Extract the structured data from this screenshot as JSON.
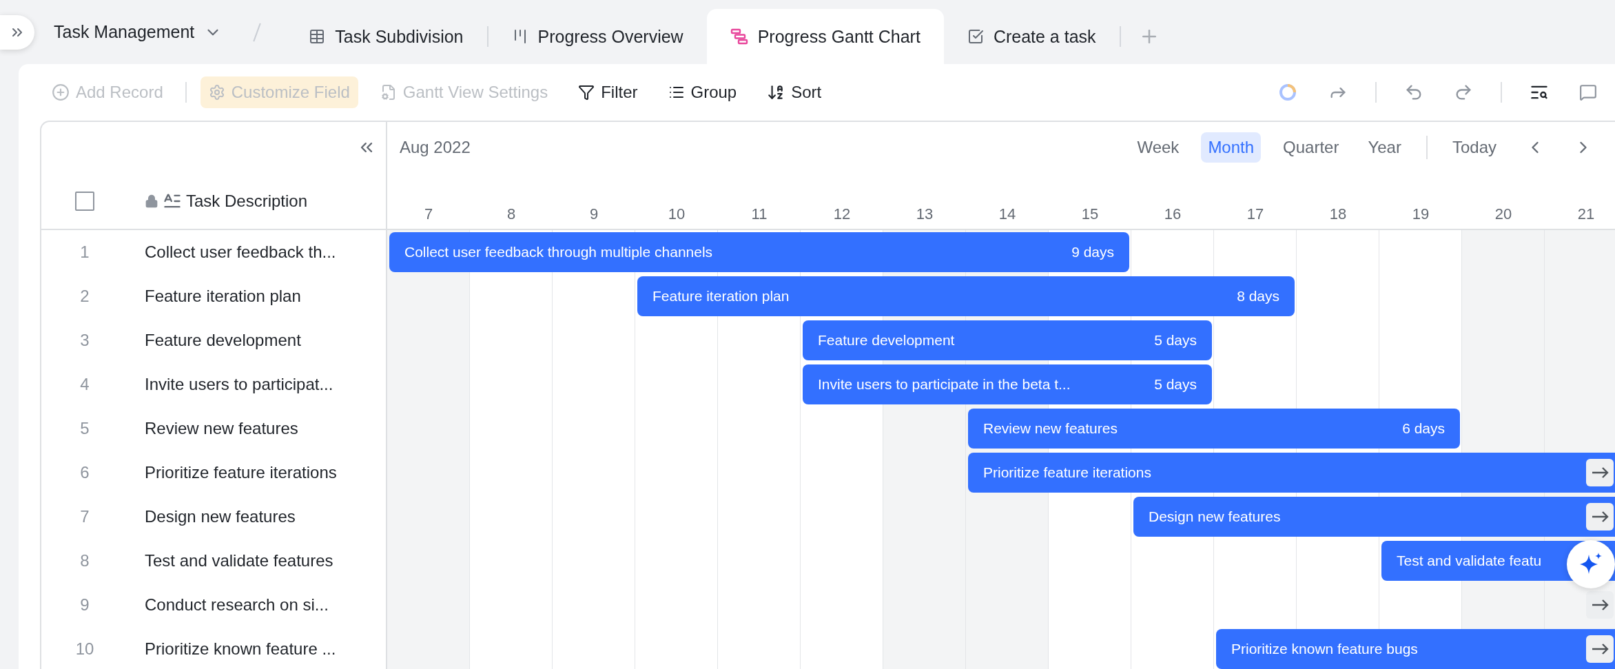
{
  "view_group": {
    "title": "Task Management"
  },
  "tabs": [
    {
      "label": "Task Subdivision",
      "kind": "grid",
      "selected": false
    },
    {
      "label": "Progress Overview",
      "kind": "kanban",
      "selected": false
    },
    {
      "label": "Progress Gantt Chart",
      "kind": "gantt",
      "selected": true
    },
    {
      "label": "Create a task",
      "kind": "form",
      "selected": false
    }
  ],
  "toolbar": [
    {
      "label": "Add Record",
      "kind": "add",
      "disabled": true,
      "highlighted": false
    },
    {
      "label": "Customize Field",
      "kind": "field",
      "disabled": true,
      "highlighted": true
    },
    {
      "label": "Gantt View Settings",
      "kind": "settings",
      "disabled": true,
      "highlighted": false
    },
    {
      "label": "Filter",
      "kind": "filter",
      "disabled": false,
      "highlighted": false
    },
    {
      "label": "Group",
      "kind": "group",
      "disabled": false,
      "highlighted": false
    },
    {
      "label": "Sort",
      "kind": "sort",
      "disabled": false,
      "highlighted": false
    }
  ],
  "gantt": {
    "month": "Aug 2022",
    "select_all": {
      "checked": false
    },
    "scales": [
      {
        "label": "Week",
        "selected": false
      },
      {
        "label": "Month",
        "selected": true
      },
      {
        "label": "Quarter",
        "selected": false
      },
      {
        "label": "Year",
        "selected": false
      }
    ],
    "today": "Today",
    "column_header": "Task Description",
    "days": [
      {
        "label": "7",
        "weekend": true
      },
      {
        "label": "8",
        "weekend": false
      },
      {
        "label": "9",
        "weekend": false
      },
      {
        "label": "10",
        "weekend": false
      },
      {
        "label": "11",
        "weekend": false
      },
      {
        "label": "12",
        "weekend": false
      },
      {
        "label": "13",
        "weekend": true
      },
      {
        "label": "14",
        "weekend": true
      },
      {
        "label": "15",
        "weekend": false
      },
      {
        "label": "16",
        "weekend": false
      },
      {
        "label": "17",
        "weekend": false
      },
      {
        "label": "18",
        "weekend": false
      },
      {
        "label": "19",
        "weekend": false
      },
      {
        "label": "20",
        "weekend": true
      },
      {
        "label": "21",
        "weekend": true
      }
    ],
    "rows": [
      {
        "number": "1",
        "description": "Collect user feedback th...",
        "bar": {
          "kind": "bounded",
          "label": "Collect user feedback through multiple channels",
          "duration": "9 days"
        },
        "timeline": [
          {
            "kind": "span"
          },
          {
            "kind": "span"
          },
          {
            "kind": "span"
          },
          {
            "kind": "span"
          },
          {
            "kind": "span"
          },
          {
            "kind": "span"
          },
          {
            "kind": "span"
          },
          {
            "kind": "span"
          },
          {
            "kind": "span"
          },
          {
            "kind": "gap"
          },
          {
            "kind": "gap"
          },
          {
            "kind": "gap"
          },
          {
            "kind": "gap"
          },
          {
            "kind": "gap"
          },
          {
            "kind": "gap"
          }
        ]
      },
      {
        "number": "2",
        "description": "Feature iteration plan",
        "bar": {
          "kind": "bounded",
          "label": "Feature iteration plan",
          "duration": "8 days"
        },
        "timeline": [
          {
            "kind": "gap"
          },
          {
            "kind": "gap"
          },
          {
            "kind": "gap"
          },
          {
            "kind": "span"
          },
          {
            "kind": "span"
          },
          {
            "kind": "span"
          },
          {
            "kind": "span"
          },
          {
            "kind": "span"
          },
          {
            "kind": "span"
          },
          {
            "kind": "span"
          },
          {
            "kind": "span"
          },
          {
            "kind": "gap"
          },
          {
            "kind": "gap"
          },
          {
            "kind": "gap"
          },
          {
            "kind": "gap"
          }
        ]
      },
      {
        "number": "3",
        "description": "Feature development",
        "bar": {
          "kind": "bounded",
          "label": "Feature development",
          "duration": "5 days"
        },
        "timeline": [
          {
            "kind": "gap"
          },
          {
            "kind": "gap"
          },
          {
            "kind": "gap"
          },
          {
            "kind": "gap"
          },
          {
            "kind": "gap"
          },
          {
            "kind": "span"
          },
          {
            "kind": "span"
          },
          {
            "kind": "span"
          },
          {
            "kind": "span"
          },
          {
            "kind": "span"
          },
          {
            "kind": "gap"
          },
          {
            "kind": "gap"
          },
          {
            "kind": "gap"
          },
          {
            "kind": "gap"
          },
          {
            "kind": "gap"
          }
        ]
      },
      {
        "number": "4",
        "description": "Invite users to participat...",
        "bar": {
          "kind": "bounded",
          "label": "Invite users to participate in the beta t...",
          "duration": "5 days"
        },
        "timeline": [
          {
            "kind": "gap"
          },
          {
            "kind": "gap"
          },
          {
            "kind": "gap"
          },
          {
            "kind": "gap"
          },
          {
            "kind": "gap"
          },
          {
            "kind": "span"
          },
          {
            "kind": "span"
          },
          {
            "kind": "span"
          },
          {
            "kind": "span"
          },
          {
            "kind": "span"
          },
          {
            "kind": "gap"
          },
          {
            "kind": "gap"
          },
          {
            "kind": "gap"
          },
          {
            "kind": "gap"
          },
          {
            "kind": "gap"
          }
        ]
      },
      {
        "number": "5",
        "description": "Review new features",
        "bar": {
          "kind": "bounded",
          "label": "Review new features",
          "duration": "6 days"
        },
        "timeline": [
          {
            "kind": "gap"
          },
          {
            "kind": "gap"
          },
          {
            "kind": "gap"
          },
          {
            "kind": "gap"
          },
          {
            "kind": "gap"
          },
          {
            "kind": "gap"
          },
          {
            "kind": "gap"
          },
          {
            "kind": "span"
          },
          {
            "kind": "span"
          },
          {
            "kind": "span"
          },
          {
            "kind": "span"
          },
          {
            "kind": "span"
          },
          {
            "kind": "span"
          },
          {
            "kind": "gap"
          },
          {
            "kind": "gap"
          }
        ]
      },
      {
        "number": "6",
        "description": "Prioritize feature iterations",
        "bar": {
          "kind": "open",
          "label": "Prioritize feature iterations",
          "arrow": true
        },
        "timeline": [
          {
            "kind": "gap"
          },
          {
            "kind": "gap"
          },
          {
            "kind": "gap"
          },
          {
            "kind": "gap"
          },
          {
            "kind": "gap"
          },
          {
            "kind": "gap"
          },
          {
            "kind": "gap"
          },
          {
            "kind": "span"
          },
          {
            "kind": "span"
          },
          {
            "kind": "span"
          },
          {
            "kind": "span"
          },
          {
            "kind": "span"
          },
          {
            "kind": "span"
          },
          {
            "kind": "span"
          },
          {
            "kind": "span"
          }
        ]
      },
      {
        "number": "7",
        "description": "Design new features",
        "bar": {
          "kind": "open",
          "label": "Design new features",
          "arrow": true
        },
        "timeline": [
          {
            "kind": "gap"
          },
          {
            "kind": "gap"
          },
          {
            "kind": "gap"
          },
          {
            "kind": "gap"
          },
          {
            "kind": "gap"
          },
          {
            "kind": "gap"
          },
          {
            "kind": "gap"
          },
          {
            "kind": "gap"
          },
          {
            "kind": "gap"
          },
          {
            "kind": "span"
          },
          {
            "kind": "span"
          },
          {
            "kind": "span"
          },
          {
            "kind": "span"
          },
          {
            "kind": "span"
          },
          {
            "kind": "span"
          }
        ]
      },
      {
        "number": "8",
        "description": "Test and validate features",
        "bar": {
          "kind": "open",
          "label": "Test and validate featu",
          "arrow": false
        },
        "timeline": [
          {
            "kind": "gap"
          },
          {
            "kind": "gap"
          },
          {
            "kind": "gap"
          },
          {
            "kind": "gap"
          },
          {
            "kind": "gap"
          },
          {
            "kind": "gap"
          },
          {
            "kind": "gap"
          },
          {
            "kind": "gap"
          },
          {
            "kind": "gap"
          },
          {
            "kind": "gap"
          },
          {
            "kind": "gap"
          },
          {
            "kind": "gap"
          },
          {
            "kind": "span"
          },
          {
            "kind": "span"
          },
          {
            "kind": "span"
          }
        ]
      },
      {
        "number": "9",
        "description": "Conduct research on si...",
        "bar": {
          "kind": "offscreen"
        }
      },
      {
        "number": "10",
        "description": "Prioritize known feature ...",
        "bar": {
          "kind": "open",
          "label": "Prioritize known feature bugs",
          "arrow": true
        },
        "timeline": [
          {
            "kind": "gap"
          },
          {
            "kind": "gap"
          },
          {
            "kind": "gap"
          },
          {
            "kind": "gap"
          },
          {
            "kind": "gap"
          },
          {
            "kind": "gap"
          },
          {
            "kind": "gap"
          },
          {
            "kind": "gap"
          },
          {
            "kind": "gap"
          },
          {
            "kind": "gap"
          },
          {
            "kind": "span"
          },
          {
            "kind": "span"
          },
          {
            "kind": "span"
          },
          {
            "kind": "span"
          },
          {
            "kind": "span"
          }
        ]
      }
    ]
  }
}
